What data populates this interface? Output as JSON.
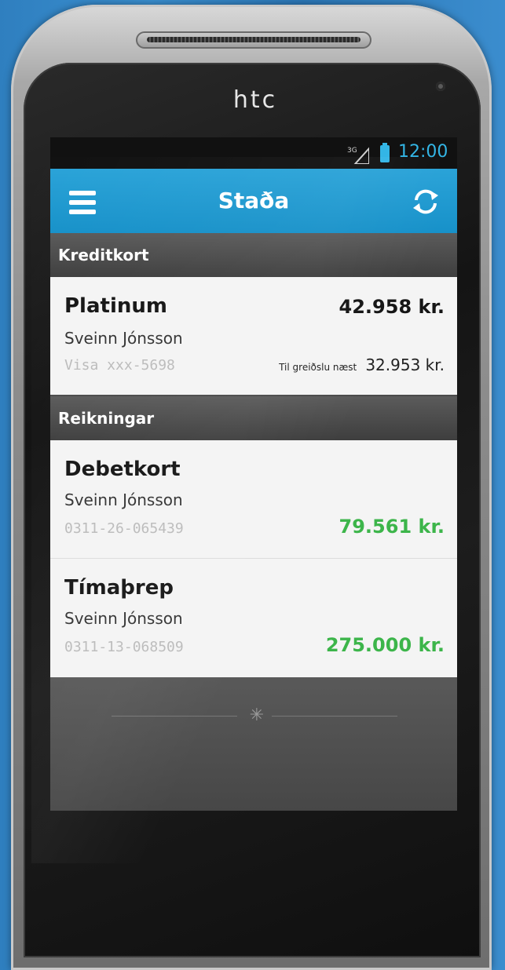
{
  "device": {
    "brand": "htc"
  },
  "status_bar": {
    "network": "3G",
    "time": "12:00"
  },
  "app_bar": {
    "title": "Staða",
    "menu_icon": "hamburger-menu-icon",
    "refresh_icon": "refresh-icon",
    "color": "#1f9bd3"
  },
  "sections": [
    {
      "title": "Kreditkort",
      "accounts": [
        {
          "name": "Platinum",
          "owner": "Sveinn Jónsson",
          "number": "Visa xxx-5698",
          "amount": "42.958 kr.",
          "next_payment_label": "Til greiðslu næst",
          "next_payment_amount": "32.953 kr."
        }
      ]
    },
    {
      "title": "Reikningar",
      "accounts": [
        {
          "name": "Debetkort",
          "owner": "Sveinn Jónsson",
          "number": "0311-26-065439",
          "amount": "79.561 kr.",
          "amount_color": "#3cb54a"
        },
        {
          "name": "Tímaþrep",
          "owner": "Sveinn Jónsson",
          "number": "0311-13-068509",
          "amount": "275.000 kr.",
          "amount_color": "#3cb54a"
        }
      ]
    }
  ]
}
